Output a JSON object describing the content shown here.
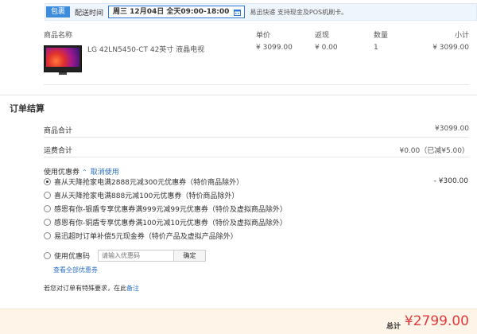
{
  "delivery": {
    "tag": "包裹",
    "label": "配送时间",
    "date": "周三 12月04日 全天09:00-18:00",
    "note": "易迅快递 支持现金及POS机刷卡。"
  },
  "products": {
    "headers": {
      "name": "商品名称",
      "price": "单价",
      "rebate": "返现",
      "qty": "数量",
      "subtotal": "小计"
    },
    "item": {
      "name": "LG 42LN5450-CT 42英寸 液晶电视",
      "price": "¥ 3099.00",
      "rebate": "¥ 0.00",
      "qty": "1",
      "subtotal": "¥ 3099.00"
    }
  },
  "settlement": {
    "title": "订单结算",
    "goods_total_label": "商品合计",
    "goods_total_value": "¥3099.00",
    "shipping_label": "运费合计",
    "shipping_value": "¥0.00（已减¥5.00）"
  },
  "coupons": {
    "title": "使用优惠券",
    "cancel": "取消使用",
    "options": [
      {
        "label": "喜从天降抢家电满2888元减300元优惠券（特价商品除外）",
        "amount": "- ¥300.00",
        "checked": true
      },
      {
        "label": "喜从天降抢家电满888元减100元优惠券（特价商品除外）",
        "amount": "",
        "checked": false
      },
      {
        "label": "感恩有你-银盾专享优惠券满999元减99元优惠券（特价及虚拟商品除外）",
        "amount": "",
        "checked": false
      },
      {
        "label": "感恩有你-铜盾专享优惠券满100元减10元优惠券（特价及虚拟商品除外）",
        "amount": "",
        "checked": false
      },
      {
        "label": "易迅超时订单补偿5元现金券（特价产品及虚拟产品除外）",
        "amount": "",
        "checked": false
      }
    ],
    "code_label": "使用优惠码",
    "code_placeholder": "请输入优惠码",
    "confirm": "确定",
    "view_all": "查看全部优惠券"
  },
  "remark": {
    "text": "若您对订单有特殊要求，在此",
    "link": "备注"
  },
  "total": {
    "label": "总计",
    "amount": "¥2799.00"
  },
  "colors": {
    "accent_blue": "#2c7ad6",
    "price_red": "#e4393c",
    "total_bg": "#fff4e8"
  }
}
